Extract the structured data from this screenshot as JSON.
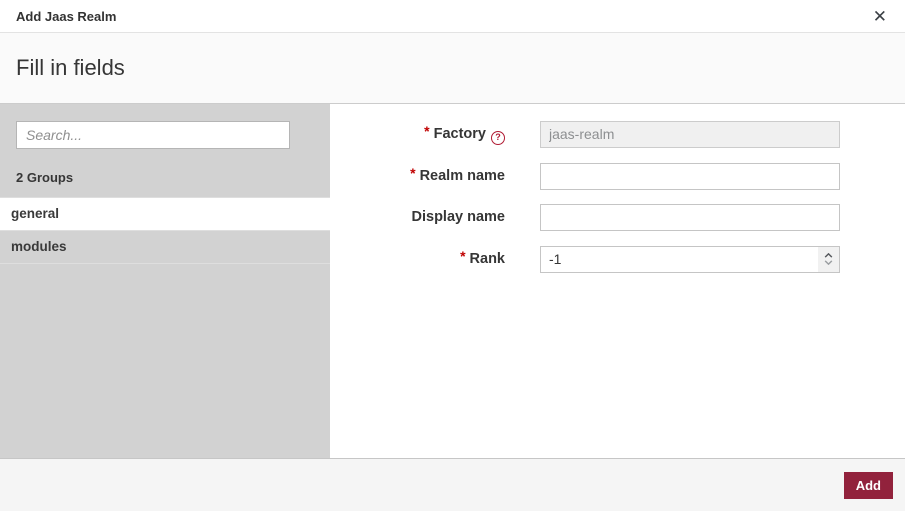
{
  "dialog": {
    "title": "Add Jaas Realm",
    "close_glyph": "✕",
    "heading": "Fill in fields"
  },
  "sidebar": {
    "search_placeholder": "Search...",
    "groups_count_label": "2 Groups",
    "groups": [
      {
        "label": "general",
        "selected": true
      },
      {
        "label": "modules",
        "selected": false
      }
    ]
  },
  "form": {
    "required_marker": "*",
    "help_glyph": "?",
    "fields": [
      {
        "label": "Factory",
        "required": true,
        "has_help": true,
        "value": "jaas-realm",
        "disabled": true,
        "type": "text"
      },
      {
        "label": "Realm name",
        "required": true,
        "has_help": false,
        "value": "",
        "disabled": false,
        "type": "text"
      },
      {
        "label": "Display name",
        "required": false,
        "has_help": false,
        "value": "",
        "disabled": false,
        "type": "text"
      },
      {
        "label": "Rank",
        "required": true,
        "has_help": false,
        "value": "-1",
        "disabled": false,
        "type": "number"
      }
    ]
  },
  "footer": {
    "add_label": "Add"
  },
  "colors": {
    "accent": "#92223c",
    "required_red": "#c00000",
    "sidebar_bg": "#d2d2d2"
  }
}
